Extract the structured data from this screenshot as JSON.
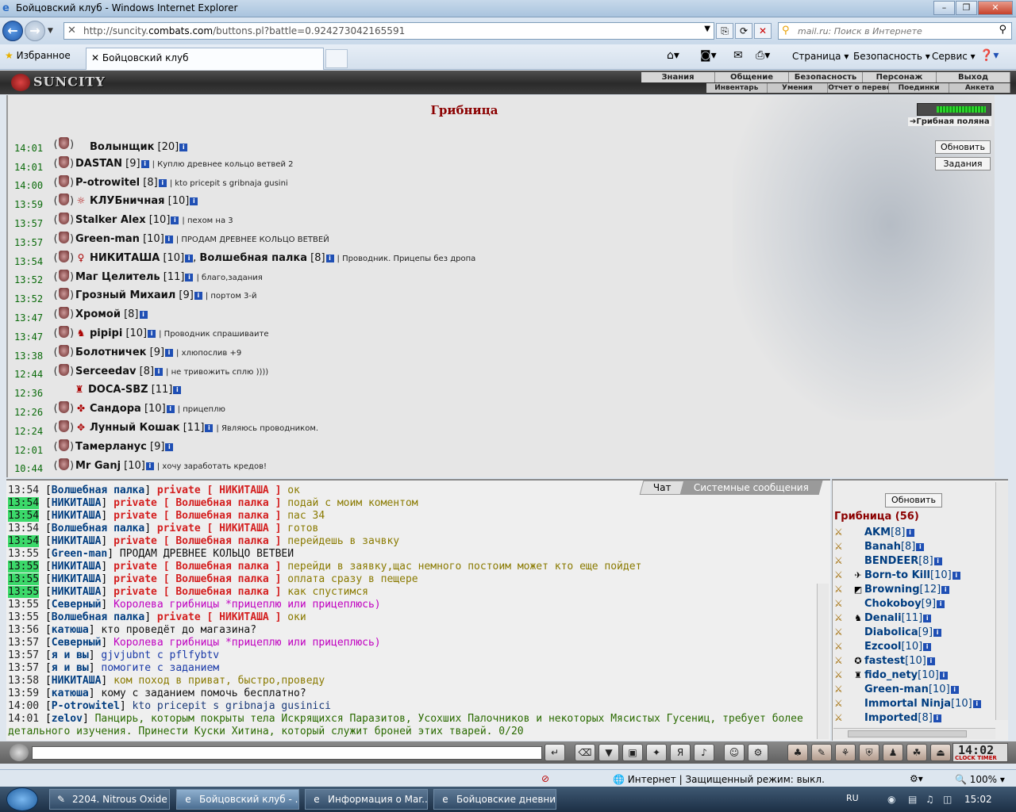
{
  "window": {
    "title": "Бойцовский клуб - Windows Internet Explorer"
  },
  "address_bar": {
    "url_prefix": "http://suncity.",
    "url_domain": "combats.com",
    "url_suffix": "/buttons.pl?battle=0.924273042165591",
    "search_placeholder": "mail.ru: Поиск в Интернете"
  },
  "favorites_bar": {
    "favorites_label": "Избранное",
    "tab_title": "Бойцовский клуб",
    "commands": [
      "Страница ▾",
      "Безопасность ▾",
      "Сервис ▾"
    ]
  },
  "game_header": {
    "logo": "SUNCITY",
    "menu_top": [
      "Знания",
      "Общение",
      "Безопасность",
      "Персонаж",
      "Выход"
    ],
    "menu_bottom": [
      "Инвентарь",
      "Умения",
      "Отчет о переводах",
      "Поединки",
      "Анкета"
    ]
  },
  "room": {
    "title": "Грибница",
    "location_link": "Грибная поляна",
    "buttons": {
      "refresh": "Обновить",
      "tasks": "Задания"
    },
    "players": [
      {
        "time": "14:01",
        "name": "Волынщик",
        "level": "[20]",
        "status": "",
        "align": ""
      },
      {
        "time": "14:01",
        "name": "DASTAN",
        "level": "[9]",
        "status": "| Куплю древнее кольцо ветвей 2",
        "align": ""
      },
      {
        "time": "14:00",
        "name": "P-otrowitel",
        "level": "[8]",
        "status": "| kto pricepit s gribnaja gusini",
        "align": ""
      },
      {
        "time": "13:59",
        "name": "КЛУБничная",
        "level": "[10]",
        "status": "",
        "align": "☼"
      },
      {
        "time": "13:57",
        "name": "Stalker Alex",
        "level": "[10]",
        "status": "| пехом на 3",
        "align": ""
      },
      {
        "time": "13:57",
        "name": "Green-man",
        "level": "[10]",
        "status": "| ПРОДАМ ДРЕВНЕЕ КОЛЬЦО ВЕТВЕЙ",
        "align": ""
      },
      {
        "time": "13:54",
        "name": "НИКИТАША",
        "level": "[10]",
        "extra_name": "Волшебная палка",
        "extra_level": "[8]",
        "status": "| Проводник. Прицепы без дропа",
        "align": "♀"
      },
      {
        "time": "13:52",
        "name": "Маг Целитель",
        "level": "[11]",
        "status": "| благо,задания",
        "align": ""
      },
      {
        "time": "13:52",
        "name": "Грозный Михаил",
        "level": "[9]",
        "status": "| портом 3-й",
        "align": ""
      },
      {
        "time": "13:47",
        "name": "Хромой",
        "level": "[8]",
        "status": "",
        "align": ""
      },
      {
        "time": "13:47",
        "name": "pipipi",
        "level": "[10]",
        "status": "| Проводник спрашиваите",
        "align": "♞"
      },
      {
        "time": "13:38",
        "name": "Болотничек",
        "level": "[9]",
        "status": "| хлюпослив +9",
        "align": ""
      },
      {
        "time": "12:44",
        "name": "Serceedav",
        "level": "[8]",
        "status": "| не тривожить сплю ))))",
        "align": ""
      },
      {
        "time": "12:36",
        "name": "DOCA-SBZ",
        "level": "[11]",
        "status": "",
        "align": "♜",
        "no_shield": true
      },
      {
        "time": "12:26",
        "name": "Сандора",
        "level": "[10]",
        "status": "| прицеплю",
        "align": "✤"
      },
      {
        "time": "12:24",
        "name": "Лунный Кошак",
        "level": "[11]",
        "status": "| Являюсь проводником.",
        "align": "✥"
      },
      {
        "time": "12:01",
        "name": "Тамерланус",
        "level": "[9]",
        "status": "",
        "align": ""
      },
      {
        "time": "10:44",
        "name": "Mr Ganj",
        "level": "[10]",
        "status": "| хочу заработать кредов!",
        "align": ""
      }
    ]
  },
  "chat": {
    "tabs": [
      "Чат",
      "Системные сообщения"
    ],
    "lines": [
      {
        "time": "13:54",
        "hl": false,
        "nick": "Волшебная палка",
        "priv": "private [ НИКИТАША ]",
        "msg": "ок",
        "color": "olive"
      },
      {
        "time": "13:54",
        "hl": true,
        "nick": "НИКИТАША",
        "priv": "private [ Волшебная палка ]",
        "msg": "подай с моим коментом",
        "color": "olive"
      },
      {
        "time": "13:54",
        "hl": true,
        "nick": "НИКИТАША",
        "priv": "private [ Волшебная палка ]",
        "msg": "пас 34",
        "color": "olive"
      },
      {
        "time": "13:54",
        "hl": false,
        "nick": "Волшебная палка",
        "priv": "private [ НИКИТАША ]",
        "msg": "готов",
        "color": "olive"
      },
      {
        "time": "13:54",
        "hl": true,
        "nick": "НИКИТАША",
        "priv": "private [ Волшебная палка ]",
        "msg": "перейдешь в зачвку",
        "color": "olive"
      },
      {
        "time": "13:55",
        "hl": false,
        "nick": "Green-man",
        "priv": "",
        "msg": "ПРОДАМ ДРЕВНЕЕ КОЛЬЦО ВЕТВЕЙ",
        "color": "black"
      },
      {
        "time": "13:55",
        "hl": true,
        "nick": "НИКИТАША",
        "priv": "private [ Волшебная палка ]",
        "msg": "перейди в заявку,щас немного постоим может кто еще пойдет",
        "color": "olive"
      },
      {
        "time": "13:55",
        "hl": true,
        "nick": "НИКИТАША",
        "priv": "private [ Волшебная палка ]",
        "msg": "оплата сразу в пещере",
        "color": "olive"
      },
      {
        "time": "13:55",
        "hl": true,
        "nick": "НИКИТАША",
        "priv": "private [ Волшебная палка ]",
        "msg": "как спустимся",
        "color": "olive"
      },
      {
        "time": "13:55",
        "hl": false,
        "nick": "Северный",
        "priv": "",
        "msg": "Королева грибницы *прицеплю или прицеплюсь)",
        "color": "magenta"
      },
      {
        "time": "13:55",
        "hl": false,
        "nick": "Волшебная палка",
        "priv": "private [ НИКИТАША ]",
        "msg": "оки",
        "color": "olive"
      },
      {
        "time": "13:56",
        "hl": false,
        "nick": "катюша",
        "priv": "",
        "msg": "кто проведёт до магазина?",
        "color": "black"
      },
      {
        "time": "13:57",
        "hl": false,
        "nick": "Северный",
        "priv": "",
        "msg": "Королева грибницы *прицеплю или прицеплюсь)",
        "color": "magenta"
      },
      {
        "time": "13:57",
        "hl": false,
        "nick": "я и вы",
        "priv": "",
        "msg": "gjvjubnt c pflfybtv",
        "color": "blue"
      },
      {
        "time": "13:57",
        "hl": false,
        "nick": "я и вы",
        "priv": "",
        "msg": "помогите с заданием",
        "color": "blue"
      },
      {
        "time": "13:58",
        "hl": false,
        "nick": "НИКИТАША",
        "priv": "",
        "msg": "ком поход в приват, быстро,проведу",
        "color": "olive"
      },
      {
        "time": "13:59",
        "hl": false,
        "nick": "катюша",
        "priv": "",
        "msg": "кому с заданием помочь бесплатно?",
        "color": "black"
      },
      {
        "time": "14:00",
        "hl": false,
        "nick": "P-otrowitel",
        "priv": "",
        "msg": "kto pricepit s gribnaja gusinici",
        "color": "dark"
      },
      {
        "time": "14:01",
        "hl": false,
        "nick": "zelov",
        "priv": "",
        "msg": "Панцирь, которым покрыты тела Искрящихся Паразитов, Усохших Палочников и некоторых Мясистых Гусениц, требует более детального изучения. Принести Куски Хитина, который служит броней этих тварей. 0/20",
        "color": "green"
      }
    ]
  },
  "online": {
    "refresh": "Обновить",
    "title": "Грибница (56)",
    "users": [
      {
        "name": "AKM",
        "level": "[8]",
        "pre": ""
      },
      {
        "name": "Banah",
        "level": "[8]",
        "pre": ""
      },
      {
        "name": "BENDEER",
        "level": "[8]",
        "pre": ""
      },
      {
        "name": "Born-to Kill",
        "level": "[10]",
        "pre": "✈"
      },
      {
        "name": "Browning",
        "level": "[12]",
        "pre": "◩"
      },
      {
        "name": "Chokoboy",
        "level": "[9]",
        "pre": ""
      },
      {
        "name": "Denali",
        "level": "[11]",
        "pre": "♞"
      },
      {
        "name": "Diabolica",
        "level": "[9]",
        "pre": ""
      },
      {
        "name": "Ezcool",
        "level": "[10]",
        "pre": ""
      },
      {
        "name": "fastest",
        "level": "[10]",
        "pre": "✪"
      },
      {
        "name": "fido_nety",
        "level": "[10]",
        "pre": "♜"
      },
      {
        "name": "Green-man",
        "level": "[10]",
        "pre": ""
      },
      {
        "name": "Immortal Ninja",
        "level": "[10]",
        "pre": ""
      },
      {
        "name": "Imported",
        "level": "[8]",
        "pre": ""
      }
    ]
  },
  "toolbar": {
    "clock": "14:02",
    "clock_label": "CLOCK TIMER"
  },
  "statusbar": {
    "zone": "Интернет | Защищенный режим: выкл.",
    "zoom": "100%"
  },
  "taskbar": {
    "tasks": [
      {
        "label": "2204. Nitrous Oxide f...",
        "active": false
      },
      {
        "label": "Бойцовский клуб - ...",
        "active": true
      },
      {
        "label": "Информация о Mar...",
        "active": false
      },
      {
        "label": "Бойцовские дневни...",
        "active": false
      }
    ],
    "lang": "RU",
    "time": "15:02"
  }
}
